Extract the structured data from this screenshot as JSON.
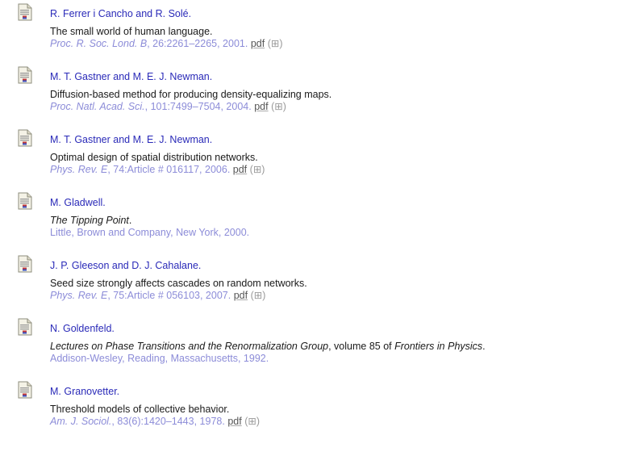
{
  "icon_name": "document-icon",
  "references": [
    {
      "authors": "R. Ferrer i Cancho and R. Solé.",
      "title": "The small world of human language.",
      "venue": "Proc. R. Soc. Lond. B",
      "details": ", 26:2261–2265, 2001.",
      "pdf": "pdf",
      "bibtex": "(⊞)"
    },
    {
      "authors": "M. T. Gastner and M. E. J. Newman.",
      "title": "Diffusion-based method for producing density-equalizing maps.",
      "venue": "Proc. Natl. Acad. Sci.",
      "details": ", 101:7499–7504, 2004.",
      "pdf": "pdf",
      "bibtex": "(⊞)"
    },
    {
      "authors": "M. T. Gastner and M. E. J. Newman.",
      "title": "Optimal design of spatial distribution networks.",
      "venue": "Phys. Rev. E",
      "details": ", 74:Article # 016117, 2006.",
      "pdf": "pdf",
      "bibtex": "(⊞)"
    },
    {
      "authors": "M. Gladwell.",
      "title_italic": "The Tipping Point",
      "title_suffix": ".",
      "publisher": "Little, Brown and Company, New York, 2000."
    },
    {
      "authors": "J. P. Gleeson and D. J. Cahalane.",
      "title": "Seed size strongly affects cascades on random networks.",
      "venue": "Phys. Rev. E",
      "details": ", 75:Article # 056103, 2007.",
      "pdf": "pdf",
      "bibtex": "(⊞)"
    },
    {
      "authors": "N. Goldenfeld.",
      "title_italic": "Lectures on Phase Transitions and the Renormalization Group",
      "title_mid": ", volume 85 of ",
      "series_italic": "Frontiers in Physics",
      "title_suffix": ".",
      "publisher": "Addison-Wesley, Reading, Massachusetts, 1992."
    },
    {
      "authors": "M. Granovetter.",
      "title": "Threshold models of collective behavior.",
      "venue": "Am. J. Sociol.",
      "details": ", 83(6):1420–1443, 1978.",
      "pdf": "pdf",
      "bibtex": "(⊞)"
    }
  ]
}
